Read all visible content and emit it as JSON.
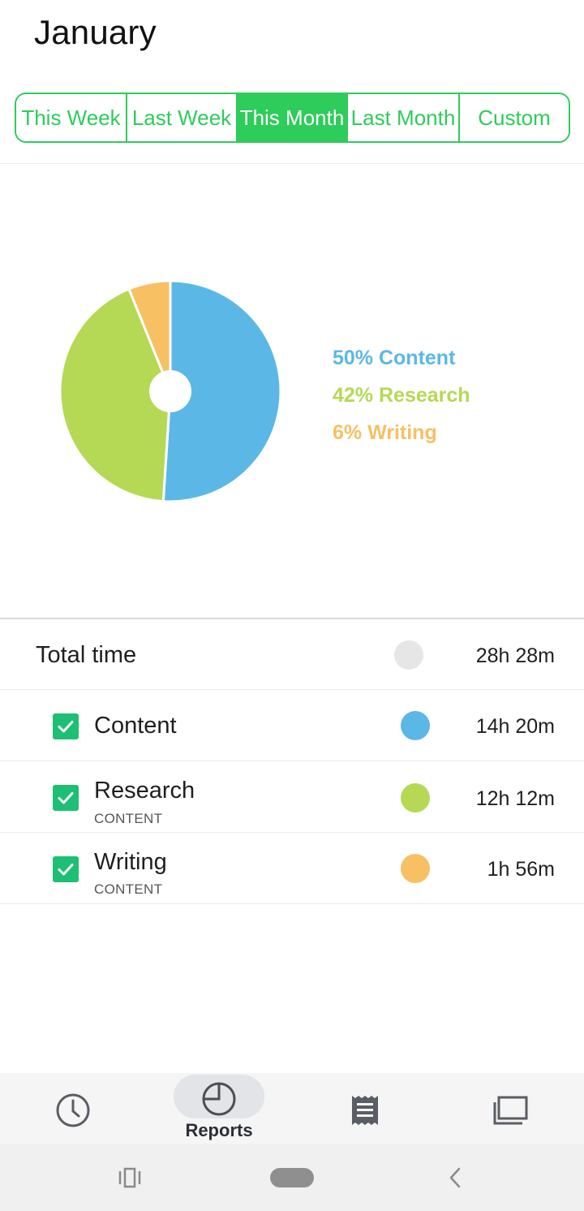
{
  "header": {
    "title": "January"
  },
  "range_tabs": [
    {
      "label": "This Week",
      "active": false
    },
    {
      "label": "Last Week",
      "active": false
    },
    {
      "label": "This Month",
      "active": true
    },
    {
      "label": "Last Month",
      "active": false
    },
    {
      "label": "Custom",
      "active": false
    }
  ],
  "colors": {
    "accent": "#2ecc5a",
    "content": "#5bb8e6",
    "research": "#b5d955",
    "writing": "#f7c063",
    "total": "#e6e6e6",
    "check": "#1dbf73"
  },
  "chart_data": {
    "type": "pie",
    "donut": true,
    "slices": [
      {
        "label": "Content",
        "percent": 50,
        "display": "50% Content",
        "color": "#5bb8e6"
      },
      {
        "label": "Research",
        "percent": 42,
        "display": "42% Research",
        "color": "#b5d955"
      },
      {
        "label": "Writing",
        "percent": 6,
        "display": "6% Writing",
        "color": "#f7c063"
      }
    ],
    "legend_position": "right"
  },
  "summary": {
    "total": {
      "label": "Total time",
      "value": "28h 28m"
    },
    "items": [
      {
        "label": "Content",
        "sub": "",
        "value": "14h 20m",
        "checked": true,
        "color": "#5bb8e6"
      },
      {
        "label": "Research",
        "sub": "CONTENT",
        "value": "12h 12m",
        "checked": true,
        "color": "#b5d955"
      },
      {
        "label": "Writing",
        "sub": "CONTENT",
        "value": "1h 56m",
        "checked": true,
        "color": "#f7c063"
      }
    ]
  },
  "bottom_nav": {
    "items": [
      {
        "icon": "clock-icon",
        "label": ""
      },
      {
        "icon": "pie-chart-icon",
        "label": "Reports",
        "active": true
      },
      {
        "icon": "receipt-icon",
        "label": ""
      },
      {
        "icon": "folders-icon",
        "label": ""
      }
    ]
  },
  "system_nav": {
    "icons": [
      "recents-icon",
      "home-icon",
      "back-icon"
    ]
  }
}
